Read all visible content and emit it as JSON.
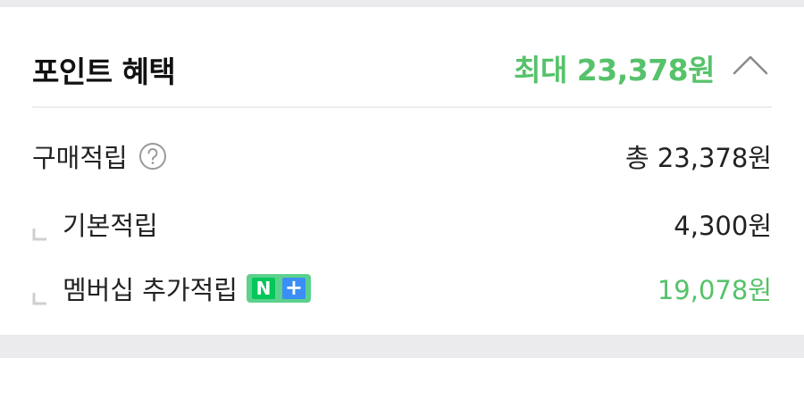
{
  "header": {
    "title": "포인트 혜택",
    "max_amount": "최대 23,378원",
    "collapse_icon": "chevron-up-icon"
  },
  "rows": {
    "purchase": {
      "label": "구매적립",
      "help_icon": "question-circle-icon",
      "value": "총 23,378원"
    },
    "basic": {
      "label": "기본적립",
      "value": "4,300원"
    },
    "membership": {
      "label": "멤버십 추가적립",
      "badge_n": "N",
      "badge_plus": "+",
      "value": "19,078원"
    }
  },
  "colors": {
    "accent_green": "#56c26a",
    "text_primary": "#222222",
    "band_gray": "#ebebee",
    "badge_green": "#03c75a",
    "badge_blue": "#3a8ef6"
  }
}
